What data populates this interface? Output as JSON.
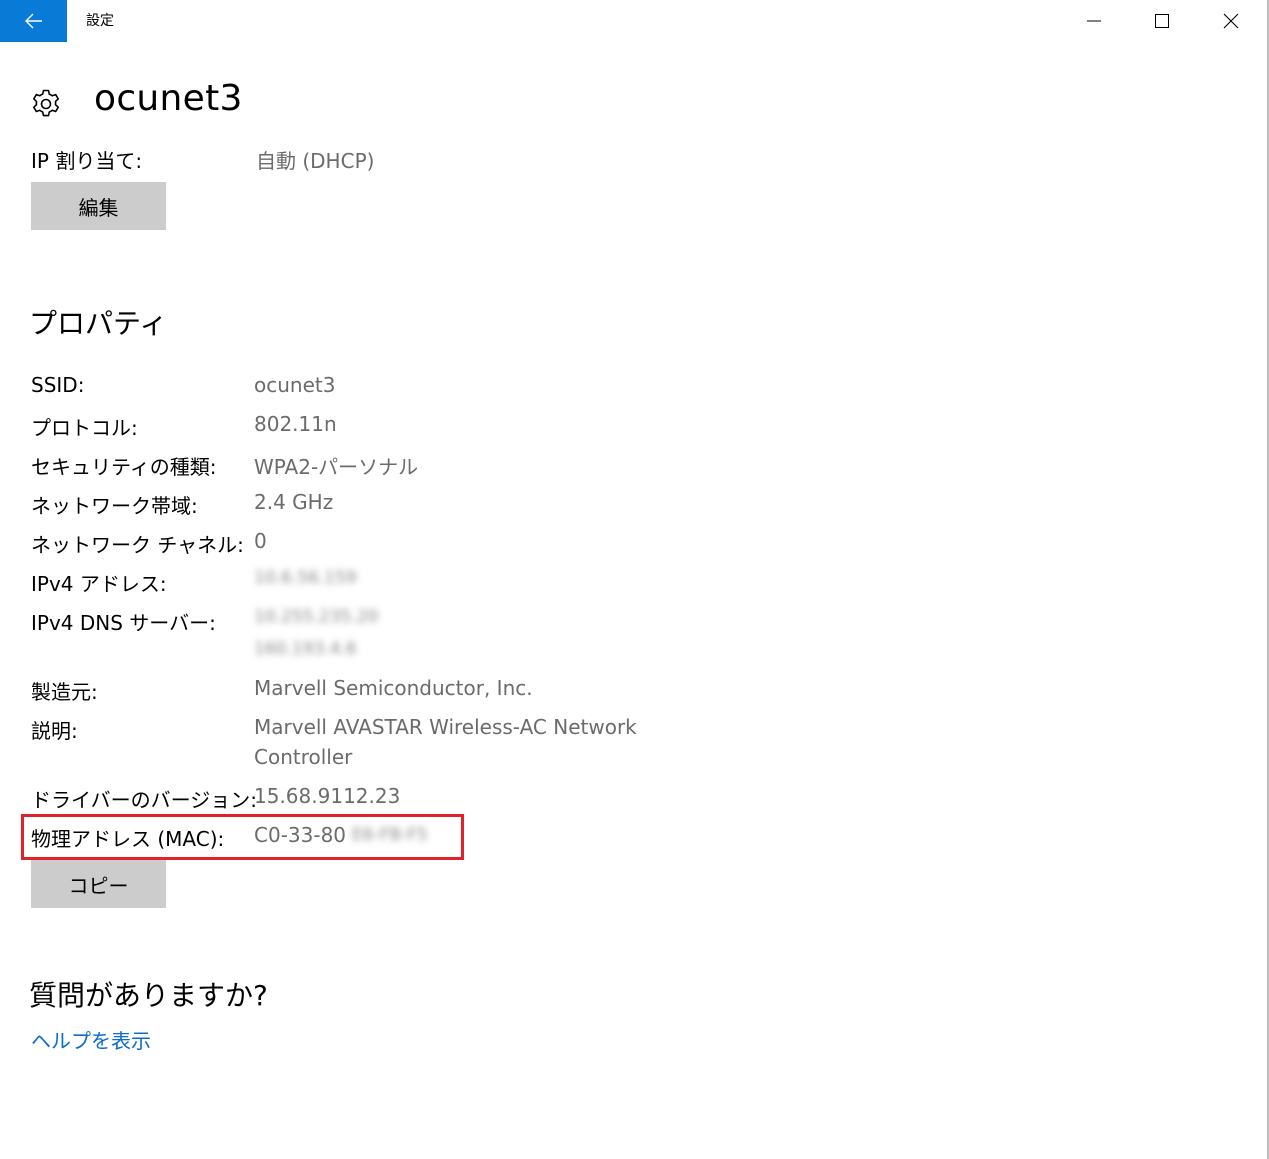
{
  "titlebar": {
    "app_title": "設定",
    "back_icon": "back-arrow-icon",
    "minimize_icon": "minimize-icon",
    "maximize_icon": "maximize-icon",
    "close_icon": "close-icon",
    "accent_color": "#0a7ad7"
  },
  "header": {
    "icon": "gear-icon",
    "title": "ocunet3"
  },
  "ip_assignment": {
    "label": "IP 割り当て:",
    "value": "自動 (DHCP)",
    "edit_button": "編集"
  },
  "properties": {
    "title": "プロパティ",
    "items": [
      {
        "label": "SSID:",
        "value": "ocunet3"
      },
      {
        "label": "プロトコル:",
        "value": "802.11n"
      },
      {
        "label": "セキュリティの種類:",
        "value": "WPA2-パーソナル"
      },
      {
        "label": "ネットワーク帯域:",
        "value": "2.4 GHz"
      },
      {
        "label": "ネットワーク チャネル:",
        "value": "0"
      },
      {
        "label": "IPv4 アドレス:",
        "value": "10.6.56.159"
      },
      {
        "label": "IPv4 DNS サーバー:",
        "value": "10.255.235.20",
        "value2": "160.193.4.6"
      },
      {
        "label": "製造元:",
        "value": "Marvell Semiconductor, Inc."
      },
      {
        "label": "説明:",
        "value": "Marvell AVASTAR Wireless-AC Network",
        "value2": "Controller"
      },
      {
        "label": "ドライバーのバージョン:",
        "value": "15.68.9112.23"
      },
      {
        "label": "物理アドレス (MAC):",
        "value": "C0-33-80",
        "value_hidden": "E6-FB-F5"
      }
    ],
    "copy_button": "コピー",
    "highlight_color": "#e1222a"
  },
  "help": {
    "title": "質問がありますか?",
    "link": "ヘルプを表示",
    "link_color": "#0a6ccf"
  }
}
